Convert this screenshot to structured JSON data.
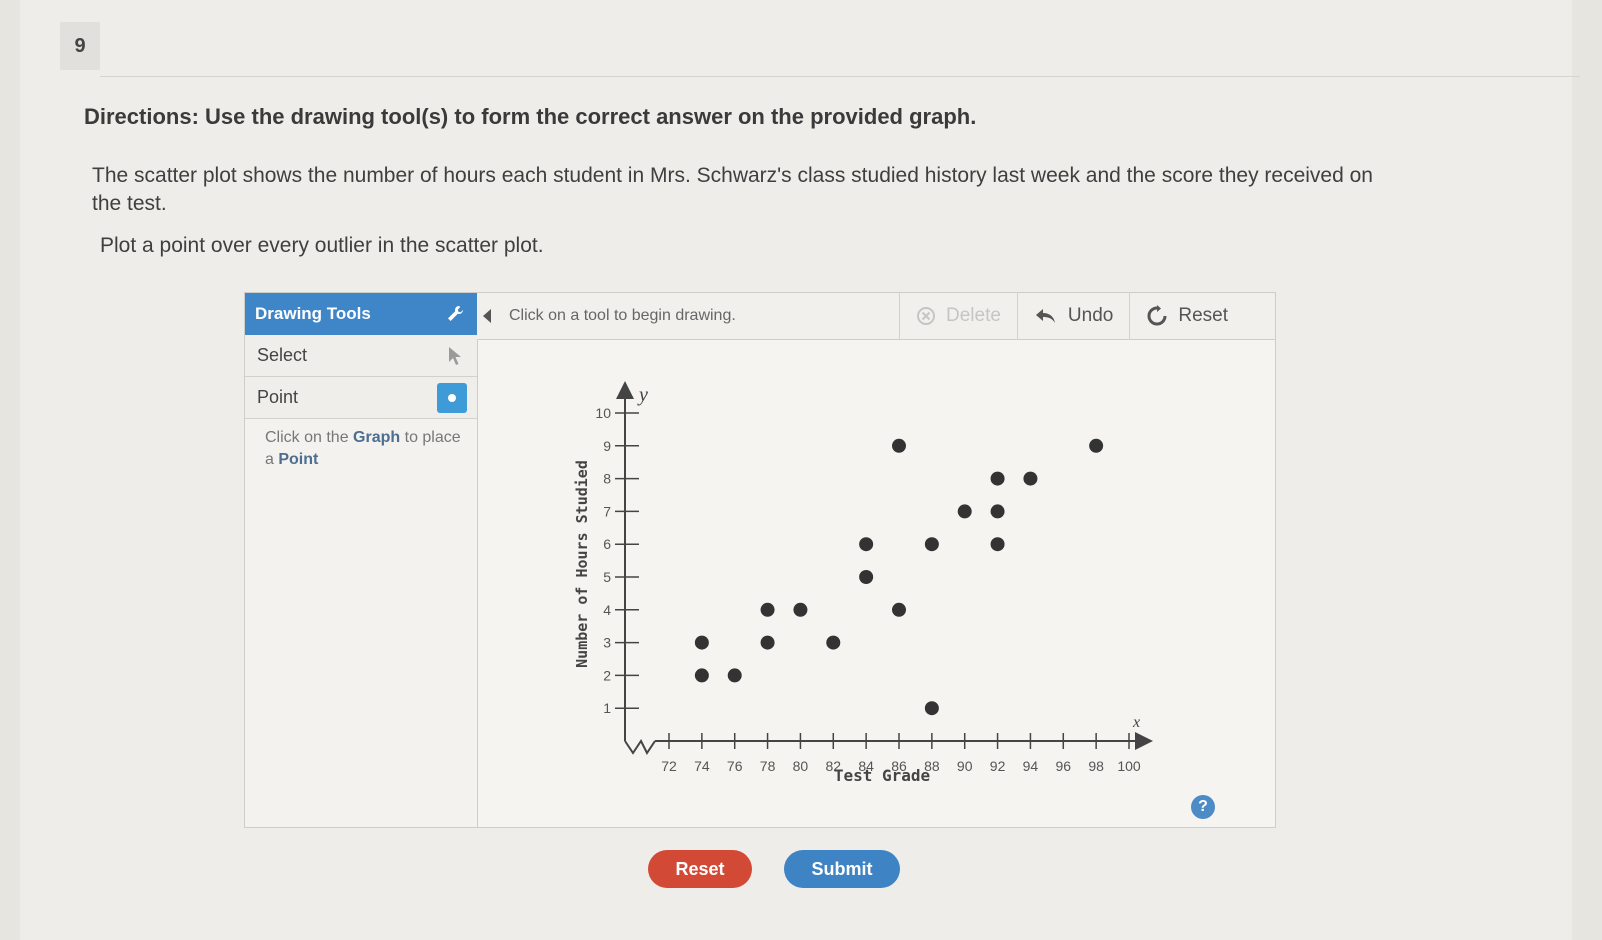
{
  "question_number": "9",
  "directions": "Directions: Use the drawing tool(s) to form the correct answer on the provided graph.",
  "description": "The scatter plot shows the number of hours each student in Mrs. Schwarz's class studied history last week and the score they received on the test.",
  "instruction": "Plot a point over every outlier in the scatter plot.",
  "tools": {
    "header": "Drawing Tools",
    "items": [
      {
        "label": "Select"
      },
      {
        "label": "Point"
      }
    ],
    "hint": {
      "pre": "Click on the ",
      "graph": "Graph",
      "mid": " to place a ",
      "point": "Point"
    }
  },
  "toolbar": {
    "message": "Click on a tool to begin drawing.",
    "delete": "Delete",
    "undo": "Undo",
    "reset": "Reset"
  },
  "buttons": {
    "reset": "Reset",
    "submit": "Submit"
  },
  "colors": {
    "accent": "#3f86c9",
    "reset": "#d24a35",
    "submit": "#3e83c4",
    "point": "#333333"
  },
  "chart_data": {
    "type": "scatter",
    "xlabel": "Test Grade",
    "ylabel": "Number of Hours Studied",
    "x_axis_name": "x",
    "y_axis_name": "y",
    "xlim": [
      72,
      100
    ],
    "ylim": [
      0,
      10
    ],
    "x_ticks": [
      72,
      74,
      76,
      78,
      80,
      82,
      84,
      86,
      88,
      90,
      92,
      94,
      96,
      98,
      100
    ],
    "y_ticks": [
      1,
      2,
      3,
      4,
      5,
      6,
      7,
      8,
      9,
      10
    ],
    "grid": false,
    "points": [
      {
        "x": 74,
        "y": 3
      },
      {
        "x": 74,
        "y": 2
      },
      {
        "x": 76,
        "y": 2
      },
      {
        "x": 78,
        "y": 4
      },
      {
        "x": 78,
        "y": 3
      },
      {
        "x": 80,
        "y": 4
      },
      {
        "x": 82,
        "y": 3
      },
      {
        "x": 84,
        "y": 6
      },
      {
        "x": 84,
        "y": 5
      },
      {
        "x": 86,
        "y": 9
      },
      {
        "x": 86,
        "y": 4
      },
      {
        "x": 88,
        "y": 6
      },
      {
        "x": 88,
        "y": 1
      },
      {
        "x": 90,
        "y": 7
      },
      {
        "x": 92,
        "y": 7
      },
      {
        "x": 92,
        "y": 8
      },
      {
        "x": 92,
        "y": 6
      },
      {
        "x": 94,
        "y": 8
      },
      {
        "x": 98,
        "y": 9
      }
    ]
  }
}
